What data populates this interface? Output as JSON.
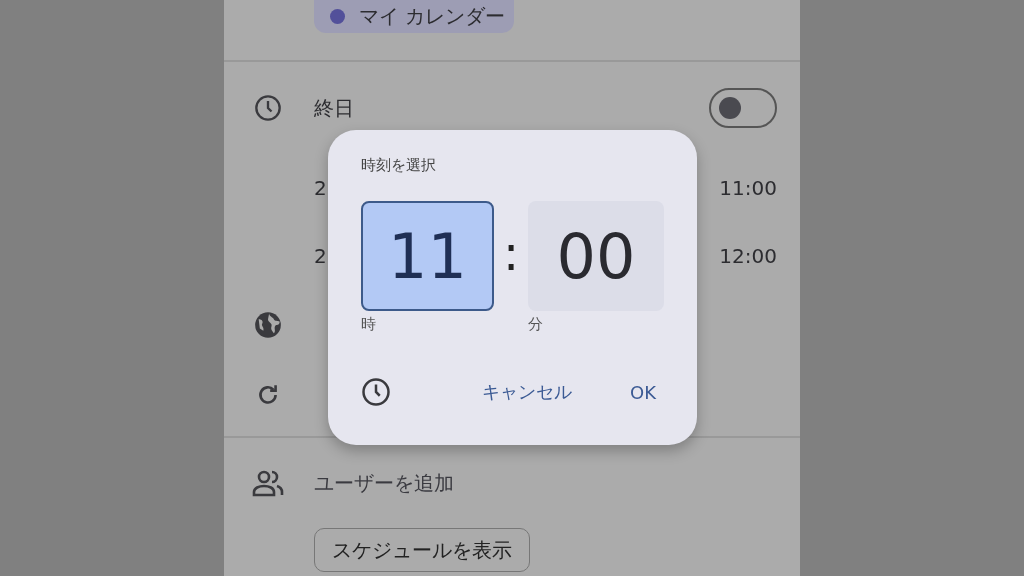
{
  "calendar_chip": {
    "label": "マイ カレンダー",
    "color": "#52509a"
  },
  "all_day": {
    "label": "終日",
    "on": false
  },
  "rows": [
    {
      "kind": "time",
      "label": "2",
      "time": "11:00"
    },
    {
      "kind": "time",
      "label": "2",
      "time": "12:00"
    },
    {
      "kind": "timezone"
    },
    {
      "kind": "repeat"
    }
  ],
  "add_people": {
    "label": "ユーザーを追加"
  },
  "schedule_button": {
    "label": "スケジュールを表示"
  },
  "dialog": {
    "title": "時刻を選択",
    "hour": {
      "value": "11",
      "label": "時",
      "selected": true
    },
    "separator": ":",
    "minute": {
      "value": "00",
      "label": "分",
      "selected": false
    },
    "buttons": [
      "キャンセル",
      "OK"
    ]
  }
}
